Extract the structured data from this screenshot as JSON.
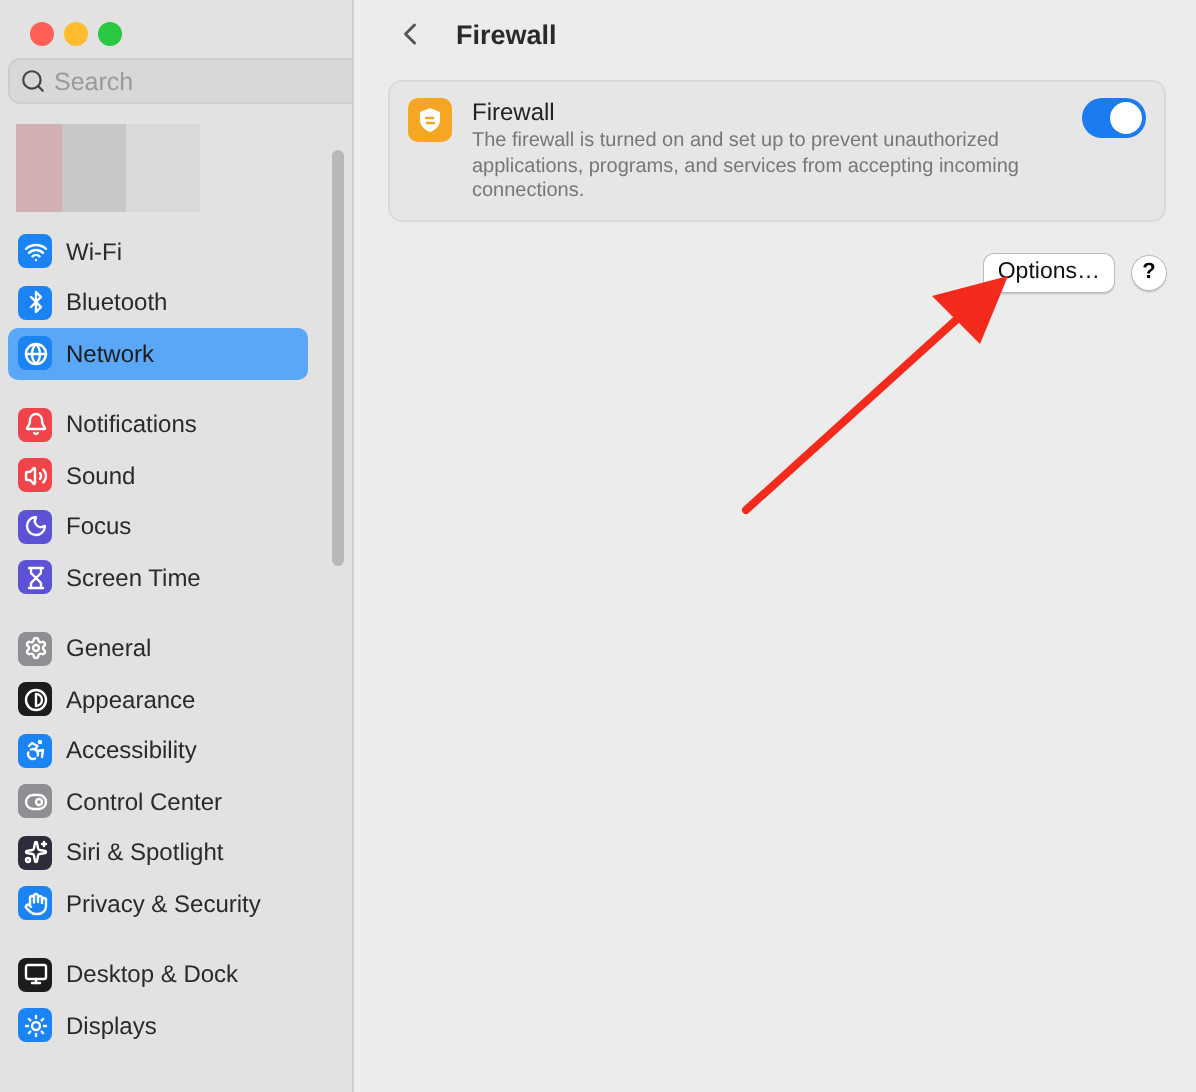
{
  "sidebar": {
    "search": {
      "placeholder": "Search"
    },
    "groups": [
      {
        "items": [
          {
            "label": "Wi-Fi",
            "color": "#1a84f5",
            "selected": false
          },
          {
            "label": "Bluetooth",
            "color": "#1a84f5",
            "selected": false
          },
          {
            "label": "Network",
            "color": "#1a84f5",
            "selected": true
          }
        ]
      },
      {
        "items": [
          {
            "label": "Notifications",
            "color": "#f0444a",
            "selected": false
          },
          {
            "label": "Sound",
            "color": "#f0444a",
            "selected": false
          },
          {
            "label": "Focus",
            "color": "#5b52d6",
            "selected": false
          },
          {
            "label": "Screen Time",
            "color": "#5b52d6",
            "selected": false
          }
        ]
      },
      {
        "items": [
          {
            "label": "General",
            "color": "#8e8e93",
            "selected": false
          },
          {
            "label": "Appearance",
            "color": "#1c1c1e",
            "selected": false
          },
          {
            "label": "Accessibility",
            "color": "#1a84f5",
            "selected": false
          },
          {
            "label": "Control Center",
            "color": "#8e8e93",
            "selected": false
          },
          {
            "label": "Siri & Spotlight",
            "color": "#2c2c3a",
            "selected": false
          },
          {
            "label": "Privacy & Security",
            "color": "#1a84f5",
            "selected": false
          }
        ]
      },
      {
        "items": [
          {
            "label": "Desktop & Dock",
            "color": "#1c1c1e",
            "selected": false
          },
          {
            "label": "Displays",
            "color": "#1a84f5",
            "selected": false
          }
        ]
      }
    ]
  },
  "header": {
    "title": "Firewall"
  },
  "firewall": {
    "title": "Firewall",
    "description": "The firewall is turned on and set up to prevent unauthorized applications, programs, and services from accepting incoming connections.",
    "on": true
  },
  "buttons": {
    "options": "Options…",
    "help": "?"
  }
}
